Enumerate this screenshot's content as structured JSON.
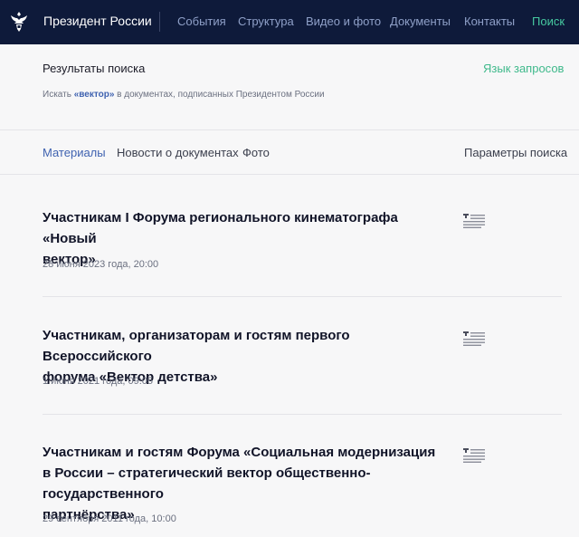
{
  "header": {
    "brand": "Президент России",
    "nav": [
      {
        "label": "События"
      },
      {
        "label": "Структура"
      },
      {
        "label": "Видео и фото"
      },
      {
        "label": "Документы"
      },
      {
        "label": "Контакты"
      },
      {
        "label": "Поиск"
      }
    ],
    "active_color": "#46c9a0",
    "bg_color": "#0e1a3a"
  },
  "subheader": {
    "title": "Результаты поиска",
    "lang_link": "Язык запросов",
    "query_prefix": "Искать ",
    "query_term": "«вектор»",
    "query_suffix": " в документах, подписанных Президентом России"
  },
  "tabs": [
    {
      "label": "Материалы",
      "active": true
    },
    {
      "label": "Новости о документах"
    },
    {
      "label": "Фото"
    }
  ],
  "params_label": "Параметры поиска",
  "results": [
    {
      "title_lines": [
        "Участникам I Форума регионального кинематографа «Новый",
        "вектор»"
      ],
      "date": "28 июня 2023 года, 20:00",
      "icon": "document-icon"
    },
    {
      "title_lines": [
        "Участникам, организаторам и гостям первого Всероссийского",
        "форума «Вектор детства»"
      ],
      "date": "1 июня 2021 года, 09:05",
      "icon": "document-icon"
    },
    {
      "title_lines": [
        "Участникам и гостям Форума «Социальная модернизация",
        "в России – стратегический вектор общественно-государственного",
        "партнёрства»"
      ],
      "date": "29 сентября 2011 года, 10:00",
      "icon": "document-icon"
    }
  ]
}
